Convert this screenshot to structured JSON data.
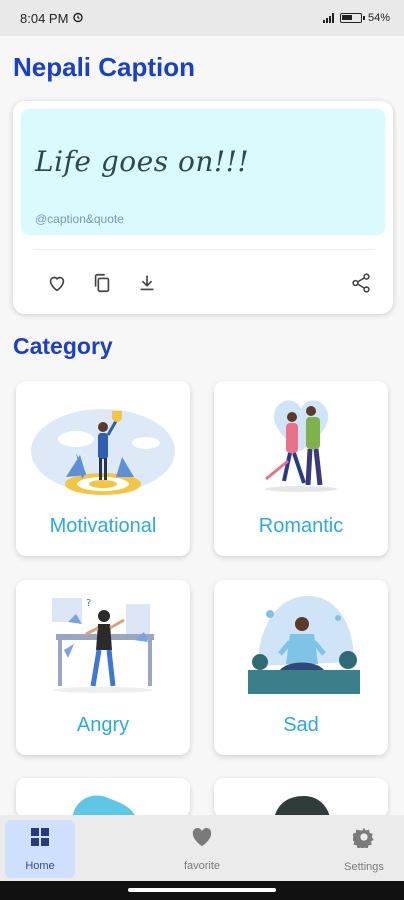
{
  "status_bar": {
    "time": "8:04 PM",
    "battery": "54"
  },
  "app": {
    "title": "Nepali Caption"
  },
  "caption_card": {
    "text": "Life goes on!!!",
    "credit": "@caption&quote",
    "actions": [
      "favorite-icon",
      "copy-icon",
      "download-icon",
      "share-icon"
    ]
  },
  "category": {
    "title": "Category",
    "items": [
      {
        "label": "Motivational"
      },
      {
        "label": "Romantic"
      },
      {
        "label": "Angry"
      },
      {
        "label": "Sad"
      }
    ]
  },
  "bottom_nav": {
    "items": [
      {
        "label": "Home",
        "icon": "dashboard-icon"
      },
      {
        "label": "favorite",
        "icon": "heart-icon"
      },
      {
        "label": "Settings",
        "icon": "gear-icon"
      }
    ]
  },
  "colors": {
    "accent": "#1a3fcc",
    "category_label": "#29abe2",
    "caption_bg": "#d9fbfd"
  }
}
